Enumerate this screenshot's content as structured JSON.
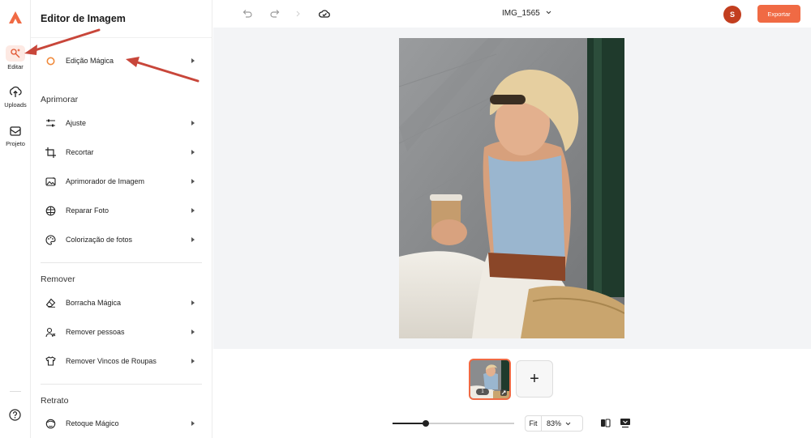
{
  "rail": {
    "items": [
      {
        "label": "Editar",
        "icon": "magic-edit-icon",
        "active": true
      },
      {
        "label": "Uploads",
        "icon": "upload-icon",
        "active": false
      },
      {
        "label": "Projeto",
        "icon": "project-icon",
        "active": false
      }
    ]
  },
  "panel": {
    "title": "Editor de Imagem",
    "magic_item": {
      "label": "Edição Mágica",
      "icon": "ring-icon"
    },
    "sections": [
      {
        "title": "Aprimorar",
        "items": [
          {
            "label": "Ajuste",
            "icon": "sliders-icon"
          },
          {
            "label": "Recortar",
            "icon": "crop-icon"
          },
          {
            "label": "Aprimorador de Imagem",
            "icon": "image-enhance-icon"
          },
          {
            "label": "Reparar Foto",
            "icon": "repair-icon"
          },
          {
            "label": "Colorização de fotos",
            "icon": "palette-icon"
          }
        ]
      },
      {
        "title": "Remover",
        "items": [
          {
            "label": "Borracha Mágica",
            "icon": "eraser-icon"
          },
          {
            "label": "Remover pessoas",
            "icon": "remove-person-icon"
          },
          {
            "label": "Remover Vincos de Roupas",
            "icon": "shirt-icon"
          }
        ]
      },
      {
        "title": "Retrato",
        "items": [
          {
            "label": "Retoque Mágico",
            "icon": "face-retouch-icon"
          }
        ]
      }
    ]
  },
  "topbar": {
    "filename": "IMG_1565",
    "avatar_initial": "S",
    "export_label": "Exportar"
  },
  "filmstrip": {
    "thumb_index": "1",
    "add_label": "+"
  },
  "zoom": {
    "fit_label": "Fit",
    "percent": "83%",
    "slider_level": 0.27
  },
  "colors": {
    "accent": "#f06a44",
    "avatar": "#c23e1f",
    "annotation_arrow": "#c8463a"
  }
}
